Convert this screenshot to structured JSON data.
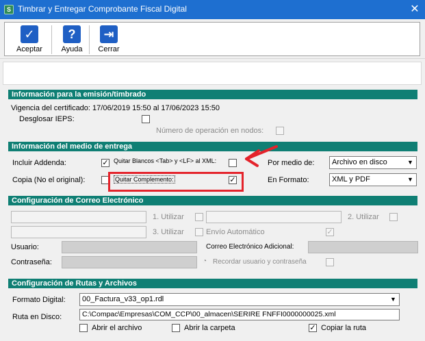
{
  "window": {
    "title": "Timbrar y Entregar Comprobante Fiscal Digital",
    "app_icon": "S"
  },
  "toolbar": {
    "aceptar": "Aceptar",
    "ayuda": "Ayuda",
    "cerrar": "Cerrar",
    "icons": {
      "aceptar": "check-icon",
      "ayuda": "help-icon",
      "cerrar": "exit-door-icon"
    }
  },
  "emision": {
    "header": "Información para la emisión/timbrado",
    "vigencia": "Vigencia del certificado: 17/06/2019 15:50 al 17/06/2023 15:50",
    "desglosar_label": "Desglosar IEPS:",
    "num_operacion_label": "Número de operación en nodos:"
  },
  "entrega": {
    "header": "Información del medio de entrega",
    "incluir_addenda_label": "Incluir Addenda:",
    "quitar_blancos_label": "Quitar Blancos <Tab> y <LF> al XML:",
    "copia_label": "Copia (No el original):",
    "quitar_complemento_label": "Quitar Complemento:",
    "por_medio_label": "Por medio de:",
    "por_medio_value": "Archivo en disco",
    "formato_label": "En Formato:",
    "formato_value": "XML y PDF"
  },
  "correo": {
    "header": "Configuración de Correo Electrónico",
    "utilizar_1": "1. Utilizar",
    "utilizar_2": "2. Utilizar",
    "utilizar_3": "3. Utilizar",
    "envio_auto": "Envío Automático",
    "usuario_label": "Usuario:",
    "correo_adicional_label": "Correo Electrónico Adicional:",
    "contrasena_label": "Contraseña:",
    "recordar_label": "Recordar usuario y contraseña"
  },
  "rutas": {
    "header": "Configuración de Rutas y Archivos",
    "formato_digital_label": "Formato Digital:",
    "formato_digital_value": "00_Factura_v33_op1.rdl",
    "ruta_label": "Ruta en Disco:",
    "ruta_value": "C:\\Compac\\Empresas\\COM_CCP\\00_almacen\\SERIRE FNFFI0000000025.xml",
    "abrir_archivo": "Abrir el archivo",
    "abrir_carpeta": "Abrir la carpeta",
    "copiar_ruta": "Copiar la ruta"
  },
  "checks": {
    "mark": "✓"
  },
  "colors": {
    "title_bar": "#1e6fd0",
    "section_header": "#0f7f74",
    "annotation": "#e4232b",
    "toolbar_icon": "#1f5fc4"
  }
}
